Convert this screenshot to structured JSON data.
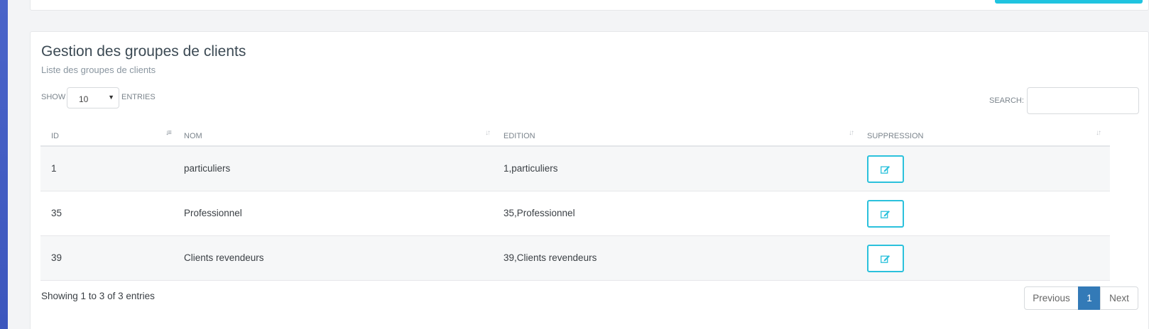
{
  "header": {
    "title": "Gestion des groupes de clients",
    "subtitle": "Liste des groupes de clients"
  },
  "controls": {
    "show_label": "SHOW",
    "length_value": "10",
    "entries_label": "ENTRIES",
    "search_label": "SEARCH:",
    "search_value": ""
  },
  "table": {
    "columns": [
      "ID",
      "NOM",
      "EDITION",
      "SUPPRESSION"
    ],
    "rows": [
      {
        "id": "1",
        "nom": "particuliers",
        "edition": "1,particuliers"
      },
      {
        "id": "35",
        "nom": "Professionnel",
        "edition": "35,Professionnel"
      },
      {
        "id": "39",
        "nom": "Clients revendeurs",
        "edition": "39,Clients revendeurs"
      }
    ]
  },
  "footer": {
    "info": "Showing 1 to 3 of 3 entries",
    "previous": "Previous",
    "current_page": "1",
    "next": "Next"
  },
  "icons": {
    "sort_active": "sort-amount-asc-icon",
    "sort_inactive": "sort-both-icon",
    "edit": "edit-icon",
    "dropdown": "caret-down-icon"
  },
  "colors": {
    "accent": "#2bc1dc",
    "pagination_active": "#337ab7",
    "sidebar": "#4a64c9"
  }
}
